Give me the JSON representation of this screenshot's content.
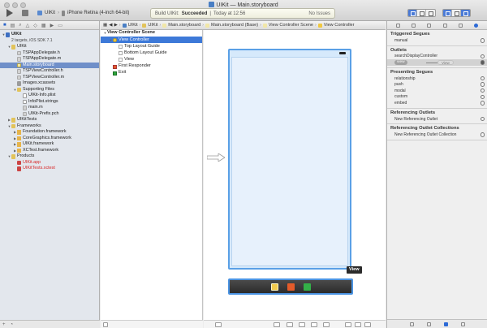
{
  "window": {
    "project": "UIKit",
    "file": "Main.storyboard",
    "separator": "—"
  },
  "toolbar": {
    "scheme_target": "UIKit",
    "scheme_device": "iPhone Retina (4-inch 64-bit)",
    "status_prefix": "Build UIKit:",
    "status_result": "Succeeded",
    "status_time": "Today at 12:56",
    "status_issues": "No Issues"
  },
  "navigator": {
    "rows": [
      {
        "label": "UIKit",
        "kind": "proj",
        "depth": 0,
        "tri": "▼",
        "bold": true
      },
      {
        "label": "2 targets, iOS SDK 7.1",
        "kind": "",
        "depth": 1,
        "tri": "",
        "sub": true
      },
      {
        "label": "UIKit",
        "kind": "folder",
        "depth": 1,
        "tri": "▼"
      },
      {
        "label": "TSPAppDelegate.h",
        "kind": "h",
        "depth": 2,
        "tri": ""
      },
      {
        "label": "TSPAppDelegate.m",
        "kind": "m",
        "depth": 2,
        "tri": ""
      },
      {
        "label": "Main.storyboard",
        "kind": "sb",
        "depth": 2,
        "tri": "",
        "selected": true
      },
      {
        "label": "TSPViewController.h",
        "kind": "h",
        "depth": 2,
        "tri": ""
      },
      {
        "label": "TSPViewController.m",
        "kind": "m",
        "depth": 2,
        "tri": ""
      },
      {
        "label": "Images.xcassets",
        "kind": "assets",
        "depth": 2,
        "tri": ""
      },
      {
        "label": "Supporting Files",
        "kind": "folder",
        "depth": 2,
        "tri": "▼"
      },
      {
        "label": "UIKit-Info.plist",
        "kind": "plist",
        "depth": 3,
        "tri": ""
      },
      {
        "label": "InfoPlist.strings",
        "kind": "plist",
        "depth": 3,
        "tri": ""
      },
      {
        "label": "main.m",
        "kind": "m",
        "depth": 3,
        "tri": ""
      },
      {
        "label": "UIKit-Prefix.pch",
        "kind": "h",
        "depth": 3,
        "tri": ""
      },
      {
        "label": "UIKitTests",
        "kind": "folder",
        "depth": 1,
        "tri": "▶"
      },
      {
        "label": "Frameworks",
        "kind": "folder",
        "depth": 1,
        "tri": "▼"
      },
      {
        "label": "Foundation.framework",
        "kind": "fw",
        "depth": 2,
        "tri": "▶"
      },
      {
        "label": "CoreGraphics.framework",
        "kind": "fw",
        "depth": 2,
        "tri": "▶"
      },
      {
        "label": "UIKit.framework",
        "kind": "fw",
        "depth": 2,
        "tri": "▶"
      },
      {
        "label": "XCTest.framework",
        "kind": "fw",
        "depth": 2,
        "tri": "▶"
      },
      {
        "label": "Products",
        "kind": "folder",
        "depth": 1,
        "tri": "▼"
      },
      {
        "label": "UIKit.app",
        "kind": "app",
        "depth": 2,
        "tri": "",
        "red": true
      },
      {
        "label": "UIKitTests.xctest",
        "kind": "app",
        "depth": 2,
        "tri": "",
        "red": true
      }
    ]
  },
  "jumpbar": {
    "items": [
      "UIKit",
      "UIKit",
      "Main.storyboard",
      "Main.storyboard (Base)",
      "View Controller Scene",
      "View Controller"
    ]
  },
  "outline": {
    "rows": [
      {
        "label": "View Controller Scene",
        "icon": "",
        "depth": 0,
        "tri": "▼",
        "bold": true
      },
      {
        "label": "View Controller",
        "icon": "vc",
        "depth": 1,
        "tri": "▼",
        "selected": true
      },
      {
        "label": "Top Layout Guide",
        "icon": "box",
        "depth": 2,
        "tri": ""
      },
      {
        "label": "Bottom Layout Guide",
        "icon": "box",
        "depth": 2,
        "tri": ""
      },
      {
        "label": "View",
        "icon": "box",
        "depth": 2,
        "tri": ""
      },
      {
        "label": "First Responder",
        "icon": "fr",
        "depth": 1,
        "tri": ""
      },
      {
        "label": "Exit",
        "icon": "ex",
        "depth": 1,
        "tri": ""
      }
    ]
  },
  "canvas": {
    "tooltip": "View"
  },
  "inspector": {
    "sections": [
      {
        "title": "Triggered Segues",
        "rows": [
          {
            "label": "manual"
          }
        ]
      },
      {
        "title": "Outlets",
        "rows": [
          {
            "label": "searchDisplayController"
          },
          {
            "label": "view",
            "connected": true,
            "target": "View"
          }
        ]
      },
      {
        "title": "Presenting Segues",
        "rows": [
          {
            "label": "relationship"
          },
          {
            "label": "push"
          },
          {
            "label": "modal"
          },
          {
            "label": "custom"
          },
          {
            "label": "embed"
          }
        ]
      },
      {
        "title": "Referencing Outlets",
        "rows": [
          {
            "label": "New Referencing Outlet"
          }
        ]
      },
      {
        "title": "Referencing Outlet Collections",
        "rows": [
          {
            "label": "New Referencing Outlet Collection"
          }
        ]
      }
    ]
  },
  "colors": {
    "accent": "#3d79d8",
    "selection_nav": "#6f8fc9",
    "scene_border": "#5aa0e6",
    "error_red": "#d82424"
  }
}
